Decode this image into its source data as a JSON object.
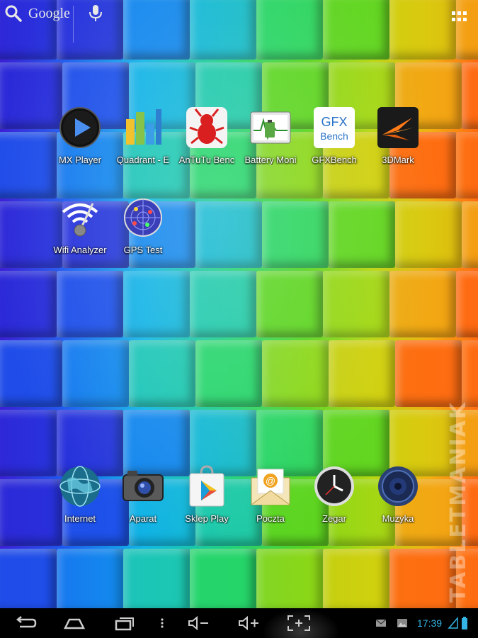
{
  "search": {
    "label": "Google"
  },
  "apps_row1": [
    {
      "label": "MX Player",
      "icon": "mx-player-icon"
    },
    {
      "label": "Quadrant - E",
      "icon": "quadrant-icon"
    },
    {
      "label": "AnTuTu Benc",
      "icon": "antutu-icon"
    },
    {
      "label": "Battery Moni",
      "icon": "battery-monitor-icon"
    },
    {
      "label": "GFXBench",
      "icon": "gfxbench-icon"
    },
    {
      "label": "3DMark",
      "icon": "3dmark-icon"
    }
  ],
  "apps_row2": [
    {
      "label": "Wifi Analyzer",
      "icon": "wifi-analyzer-icon"
    },
    {
      "label": "GPS Test",
      "icon": "gps-test-icon"
    }
  ],
  "dock": [
    {
      "label": "Internet",
      "icon": "globe-icon"
    },
    {
      "label": "Aparat",
      "icon": "camera-icon"
    },
    {
      "label": "Sklep Play",
      "icon": "play-store-icon"
    },
    {
      "label": "Poczta",
      "icon": "mail-icon"
    },
    {
      "label": "Zegar",
      "icon": "clock-icon"
    },
    {
      "label": "Muzyka",
      "icon": "music-icon"
    }
  ],
  "gfx_text": {
    "top": "GFX",
    "bottom": "Bench"
  },
  "watermark": "TABLETMANIAK",
  "status": {
    "time": "17:39"
  },
  "colors": {
    "clock": "#34b5e5"
  }
}
